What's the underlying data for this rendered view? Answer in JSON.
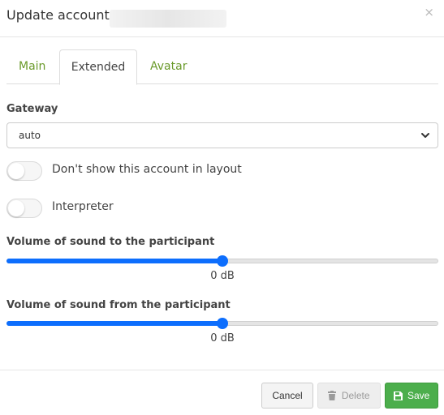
{
  "header": {
    "title": "Update account",
    "close_glyph": "×"
  },
  "tabs": [
    {
      "label": "Main",
      "active": false
    },
    {
      "label": "Extended",
      "active": true
    },
    {
      "label": "Avatar",
      "active": false
    }
  ],
  "gateway": {
    "label": "Gateway",
    "value": "auto"
  },
  "toggles": [
    {
      "label": "Don't show this account in layout",
      "on": false
    },
    {
      "label": "Interpreter",
      "on": false
    }
  ],
  "volume_to": {
    "label": "Volume of sound to the participant",
    "value_text": "0 dB",
    "level": 0.5
  },
  "volume_from": {
    "label": "Volume of sound from the participant",
    "value_text": "0 dB",
    "level": 0.5
  },
  "footer": {
    "cancel_label": "Cancel",
    "delete_label": "Delete",
    "save_label": "Save"
  },
  "colors": {
    "tab_link": "#6a9a2a",
    "slider_accent": "#0d6efd",
    "save_button": "#4cae4c"
  },
  "icons": {
    "close": "close-icon",
    "select_chevron": "chevron-down-icon",
    "delete": "trash-icon",
    "save": "floppy-disk-icon"
  }
}
